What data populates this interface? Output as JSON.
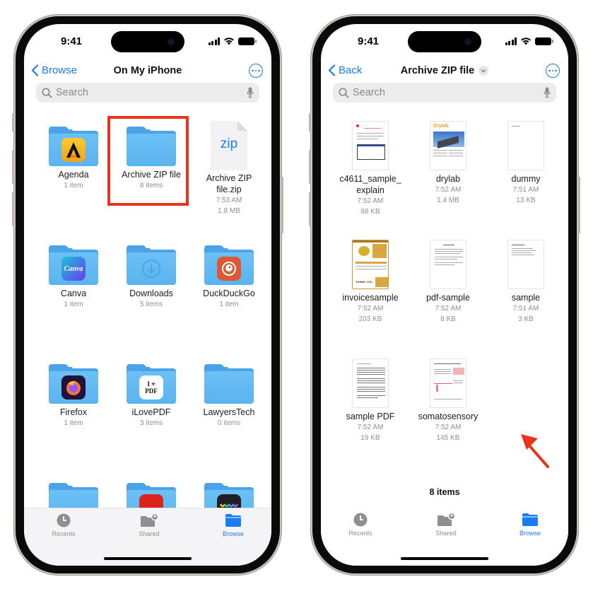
{
  "left_phone": {
    "status": {
      "time": "9:41"
    },
    "nav": {
      "back_label": "Browse",
      "title": "On My iPhone"
    },
    "search": {
      "placeholder": "Search"
    },
    "items": [
      {
        "name": "Agenda",
        "meta1": "1 item",
        "type": "folder",
        "app_icon": "agenda-icon"
      },
      {
        "name": "Archive ZIP file",
        "meta1": "8 items",
        "type": "folder",
        "highlighted": true
      },
      {
        "name": "Archive ZIP file.zip",
        "name_line1": "Archive ZIP",
        "name_line2": "file.zip",
        "meta1": "7:53 AM",
        "meta2": "1.8 MB",
        "type": "zip",
        "icon_text": "zip"
      },
      {
        "name": "Canva",
        "meta1": "1 item",
        "type": "folder",
        "app_icon": "canva-icon",
        "icon_text": "Canva"
      },
      {
        "name": "Downloads",
        "meta1": "5 items",
        "type": "folder",
        "app_icon": "download-icon"
      },
      {
        "name": "DuckDuckGo",
        "meta1": "1 item",
        "type": "folder",
        "app_icon": "duckduckgo-icon"
      },
      {
        "name": "Firefox",
        "meta1": "1 item",
        "type": "folder",
        "app_icon": "firefox-icon"
      },
      {
        "name": "iLovePDF",
        "meta1": "3 items",
        "type": "folder",
        "app_icon": "ilovepdf-icon",
        "icon_text": "I ♥ PDF"
      },
      {
        "name": "LawyersTech",
        "meta1": "0 items",
        "type": "folder"
      }
    ],
    "tabbar": [
      {
        "label": "Recents",
        "icon": "clock-icon"
      },
      {
        "label": "Shared",
        "icon": "shared-folder-icon"
      },
      {
        "label": "Browse",
        "icon": "folder-icon",
        "active": true
      }
    ]
  },
  "right_phone": {
    "status": {
      "time": "9:41"
    },
    "nav": {
      "back_label": "Back",
      "title": "Archive ZIP file"
    },
    "search": {
      "placeholder": "Search"
    },
    "items": [
      {
        "name_line1": "c4611_sample_",
        "name_line2": "explain",
        "meta1": "7:52 AM",
        "meta2": "88 KB"
      },
      {
        "name": "drylab",
        "meta1": "7:52 AM",
        "meta2": "1.4 MB",
        "thumb_text": "Drylab"
      },
      {
        "name": "dummy",
        "meta1": "7:51 AM",
        "meta2": "13 KB"
      },
      {
        "name": "invoicesample",
        "meta1": "7:52 AM",
        "meta2": "203 KB",
        "thumb_text": "THANK YOU"
      },
      {
        "name": "pdf-sample",
        "meta1": "7:52 AM",
        "meta2": "8 KB"
      },
      {
        "name": "sample",
        "meta1": "7:51 AM",
        "meta2": "3 KB"
      },
      {
        "name": "sample PDF",
        "meta1": "7:52 AM",
        "meta2": "19 KB"
      },
      {
        "name": "somatosensory",
        "meta1": "7:52 AM",
        "meta2": "145 KB"
      }
    ],
    "count_label": "8 items",
    "tabbar": [
      {
        "label": "Recents",
        "icon": "clock-icon"
      },
      {
        "label": "Shared",
        "icon": "shared-folder-icon"
      },
      {
        "label": "Browse",
        "icon": "folder-icon",
        "active": true
      }
    ]
  },
  "colors": {
    "accent": "#1a7cf0",
    "highlight": "#e8341c",
    "folder": "#5ab4ef"
  }
}
